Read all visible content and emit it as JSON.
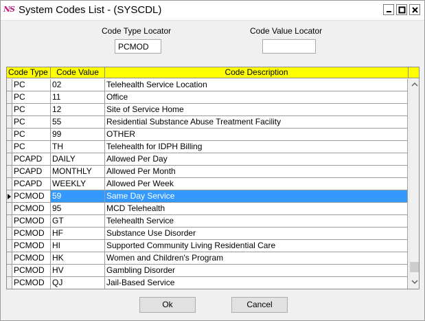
{
  "window": {
    "title": "System Codes List - (SYSCDL)",
    "app_icon_text": "NS"
  },
  "locators": {
    "code_type_label": "Code Type Locator",
    "code_type_value": "PCMOD",
    "code_value_label": "Code Value Locator",
    "code_value_value": ""
  },
  "grid": {
    "columns": [
      "Code Type",
      "Code Value",
      "Code Description"
    ],
    "rows": [
      {
        "type": "PC",
        "value": "02",
        "desc": "Telehealth Service Location"
      },
      {
        "type": "PC",
        "value": "11",
        "desc": "Office"
      },
      {
        "type": "PC",
        "value": "12",
        "desc": "Site of Service Home"
      },
      {
        "type": "PC",
        "value": "55",
        "desc": "Residential Substance Abuse Treatment Facility"
      },
      {
        "type": "PC",
        "value": "99",
        "desc": "OTHER"
      },
      {
        "type": "PC",
        "value": "TH",
        "desc": "Telehealth for IDPH Billing"
      },
      {
        "type": "PCAPD",
        "value": "DAILY",
        "desc": "Allowed Per Day"
      },
      {
        "type": "PCAPD",
        "value": "MONTHLY",
        "desc": "Allowed Per Month"
      },
      {
        "type": "PCAPD",
        "value": "WEEKLY",
        "desc": "Allowed Per Week"
      },
      {
        "type": "PCMOD",
        "value": "59",
        "desc": "Same Day Service"
      },
      {
        "type": "PCMOD",
        "value": "95",
        "desc": "MCD Telehealth"
      },
      {
        "type": "PCMOD",
        "value": "GT",
        "desc": "Telehealth Service"
      },
      {
        "type": "PCMOD",
        "value": "HF",
        "desc": "Substance Use Disorder"
      },
      {
        "type": "PCMOD",
        "value": "HI",
        "desc": "Supported Community Living Residential Care"
      },
      {
        "type": "PCMOD",
        "value": "HK",
        "desc": "Women and Children's Program"
      },
      {
        "type": "PCMOD",
        "value": "HV",
        "desc": "Gambling Disorder"
      },
      {
        "type": "PCMOD",
        "value": "QJ",
        "desc": "Jail-Based Service"
      }
    ],
    "selected_row": 9
  },
  "buttons": {
    "ok": "Ok",
    "cancel": "Cancel"
  },
  "colors": {
    "header_bg": "#ffff00",
    "selection_bg": "#3399ff"
  }
}
